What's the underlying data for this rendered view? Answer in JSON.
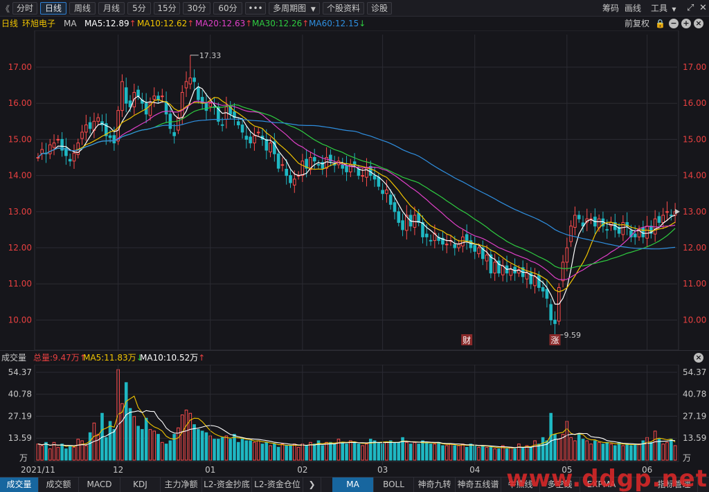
{
  "toolbar": {
    "collapse": "《",
    "periods": [
      "分时",
      "日线",
      "周线",
      "月线",
      "5分",
      "15分",
      "30分",
      "60分"
    ],
    "active_period": "日线",
    "more": "•••",
    "multi_period": "多周期图",
    "stock_info": "个股资料",
    "diagnose": "诊股",
    "right": [
      "筹码",
      "画线",
      "工具"
    ]
  },
  "main_legend": {
    "period": "日线",
    "stock_name": "环旭电子",
    "ma_label": "MA",
    "items": [
      {
        "label": "MA5:12.89",
        "arrow": "↑",
        "color": "#ffffff"
      },
      {
        "label": "MA10:12.62",
        "arrow": "↑",
        "color": "#f2c500"
      },
      {
        "label": "MA20:12.63",
        "arrow": "↑",
        "color": "#e040c8"
      },
      {
        "label": "MA30:12.26",
        "arrow": "↑",
        "color": "#2ecc40"
      },
      {
        "label": "MA60:12.15",
        "arrow": "↓",
        "color": "#2f8fe0"
      }
    ],
    "adjust": "前复权"
  },
  "price_axis": {
    "ticks": [
      "17.00",
      "16.00",
      "15.00",
      "14.00",
      "13.00",
      "12.00",
      "11.00",
      "10.00"
    ],
    "high_label": "17.33",
    "low_label": "9.59",
    "markers": [
      {
        "text": "财",
        "color": "#c0392b"
      },
      {
        "text": "涨",
        "color": "#c0392b"
      }
    ]
  },
  "volume_legend": {
    "title": "成交量",
    "total": "总量:9.47万",
    "total_arrow": "↑",
    "ma5": "MA5:11.83万",
    "ma5_arrow": "↓",
    "ma10": "MA10:10.52万",
    "ma10_arrow": "↑"
  },
  "volume_axis": {
    "ticks": [
      "54.37",
      "40.78",
      "27.19",
      "13.59"
    ],
    "unit": "万"
  },
  "date_axis": [
    "2021/11",
    "12",
    "01",
    "02",
    "03",
    "04",
    "05",
    "06"
  ],
  "bottom_tabs_left": [
    "成交量",
    "成交额",
    "MACD",
    "KDJ",
    "主力净额",
    "L2-资金抄底",
    "L2-资金仓位"
  ],
  "bottom_tabs_right": [
    "MA",
    "BOLL",
    "神奇九转",
    "神奇五线谱",
    "牛熊线",
    "多空线",
    "EXPMA",
    "指标管理"
  ],
  "active_left_tab": "成交量",
  "active_right_tab": "MA",
  "watermark": "www.ddgp.net",
  "chart_data": {
    "type": "candlestick",
    "stock": "环旭电子",
    "period": "日线",
    "ylim": [
      9.3,
      17.9
    ],
    "volume_ylim": [
      0,
      56.5
    ],
    "volume_unit": "万",
    "month_ticks": [
      {
        "label": "12",
        "index": 20
      },
      {
        "label": "01",
        "index": 43
      },
      {
        "label": "02",
        "index": 66
      },
      {
        "label": "03",
        "index": 86
      },
      {
        "label": "04",
        "index": 109
      },
      {
        "label": "05",
        "index": 132
      },
      {
        "label": "06",
        "index": 152
      }
    ],
    "high_point": {
      "index": 38,
      "value": 17.33
    },
    "low_point": {
      "index": 129,
      "value": 9.59
    },
    "event_markers": [
      {
        "text": "财",
        "index": 107
      },
      {
        "text": "涨",
        "index": 129
      }
    ],
    "closes": [
      14.5,
      14.72,
      14.6,
      14.85,
      14.9,
      15.0,
      14.7,
      14.55,
      14.4,
      14.62,
      14.9,
      15.2,
      15.4,
      15.3,
      15.5,
      15.6,
      15.4,
      15.1,
      15.05,
      14.9,
      15.8,
      16.6,
      16.0,
      15.9,
      16.3,
      16.2,
      16.0,
      15.7,
      16.0,
      16.2,
      16.1,
      16.2,
      15.7,
      15.3,
      15.1,
      15.6,
      16.3,
      16.6,
      16.7,
      16.6,
      16.1,
      16.0,
      15.8,
      16.0,
      15.9,
      15.5,
      15.4,
      15.9,
      15.7,
      15.6,
      15.4,
      15.2,
      15.0,
      14.9,
      15.1,
      15.2,
      15.0,
      14.7,
      14.9,
      14.6,
      14.2,
      14.3,
      14.0,
      13.8,
      13.9,
      14.0,
      14.4,
      14.2,
      14.5,
      14.4,
      14.3,
      14.2,
      14.5,
      14.4,
      14.3,
      14.4,
      14.2,
      14.1,
      14.3,
      14.3,
      14.0,
      14.0,
      14.2,
      14.0,
      13.9,
      13.7,
      13.5,
      13.6,
      13.2,
      13.0,
      12.7,
      12.5,
      12.9,
      12.6,
      12.9,
      12.7,
      12.3,
      12.3,
      12.2,
      12.4,
      12.2,
      12.1,
      12.1,
      12.2,
      12.0,
      12.1,
      12.3,
      12.2,
      12.0,
      11.9,
      12.0,
      11.7,
      11.8,
      11.3,
      11.6,
      11.3,
      11.5,
      11.3,
      11.4,
      11.3,
      11.4,
      11.2,
      11.3,
      11.0,
      11.2,
      10.9,
      10.8,
      10.6,
      10.0,
      9.9,
      10.9,
      11.6,
      12.0,
      12.6,
      12.9,
      12.8,
      12.6,
      12.8,
      12.8,
      12.6,
      12.8,
      12.6,
      12.5,
      12.7,
      12.5,
      12.4,
      12.7,
      12.6,
      12.3,
      12.3,
      12.5,
      12.3,
      12.6,
      12.4,
      12.8,
      12.7,
      12.9,
      13.0,
      12.9,
      13.0
    ],
    "volumes": [
      10,
      9,
      11,
      7,
      11,
      8,
      10,
      7,
      9,
      8,
      13,
      12,
      9,
      17,
      23,
      16,
      29,
      14,
      24,
      19,
      56,
      35,
      48,
      32,
      27,
      21,
      19,
      26,
      19,
      18,
      16,
      11,
      10,
      12,
      16,
      20,
      28,
      31,
      29,
      22,
      19,
      18,
      17,
      15,
      13,
      13,
      14,
      15,
      13,
      16,
      11,
      13,
      12,
      12,
      11,
      12,
      10,
      11,
      9,
      10,
      8,
      10,
      9,
      9,
      10,
      8,
      10,
      9,
      11,
      10,
      12,
      9,
      11,
      11,
      10,
      13,
      11,
      10,
      12,
      11,
      10,
      9,
      10,
      13,
      12,
      11,
      10,
      11,
      12,
      11,
      11,
      14,
      11,
      10,
      11,
      10,
      12,
      11,
      10,
      10,
      11,
      9,
      9,
      10,
      9,
      9,
      10,
      8,
      10,
      9,
      8,
      9,
      8,
      8,
      7,
      7,
      9,
      7,
      8,
      7,
      10,
      8,
      9,
      8,
      12,
      10,
      14,
      12,
      29,
      16,
      13,
      16,
      24,
      14,
      12,
      16,
      13,
      12,
      10,
      12,
      11,
      10,
      11,
      10,
      9,
      11,
      9,
      10,
      9,
      10,
      10,
      12,
      14,
      11,
      18,
      13,
      10,
      11,
      13,
      9
    ],
    "series": [
      {
        "name": "MA5",
        "color": "#ffffff",
        "last": 12.89
      },
      {
        "name": "MA10",
        "color": "#f2c500",
        "last": 12.62
      },
      {
        "name": "MA20",
        "color": "#e040c8",
        "last": 12.63
      },
      {
        "name": "MA30",
        "color": "#2ecc40",
        "last": 12.26
      },
      {
        "name": "MA60",
        "color": "#2f8fe0",
        "last": 12.15
      }
    ],
    "volume_series": [
      {
        "name": "MA5",
        "color": "#f2c500",
        "last": 11.83
      },
      {
        "name": "MA10",
        "color": "#ffffff",
        "last": 10.52
      }
    ],
    "current_price_marker": 13.0
  }
}
